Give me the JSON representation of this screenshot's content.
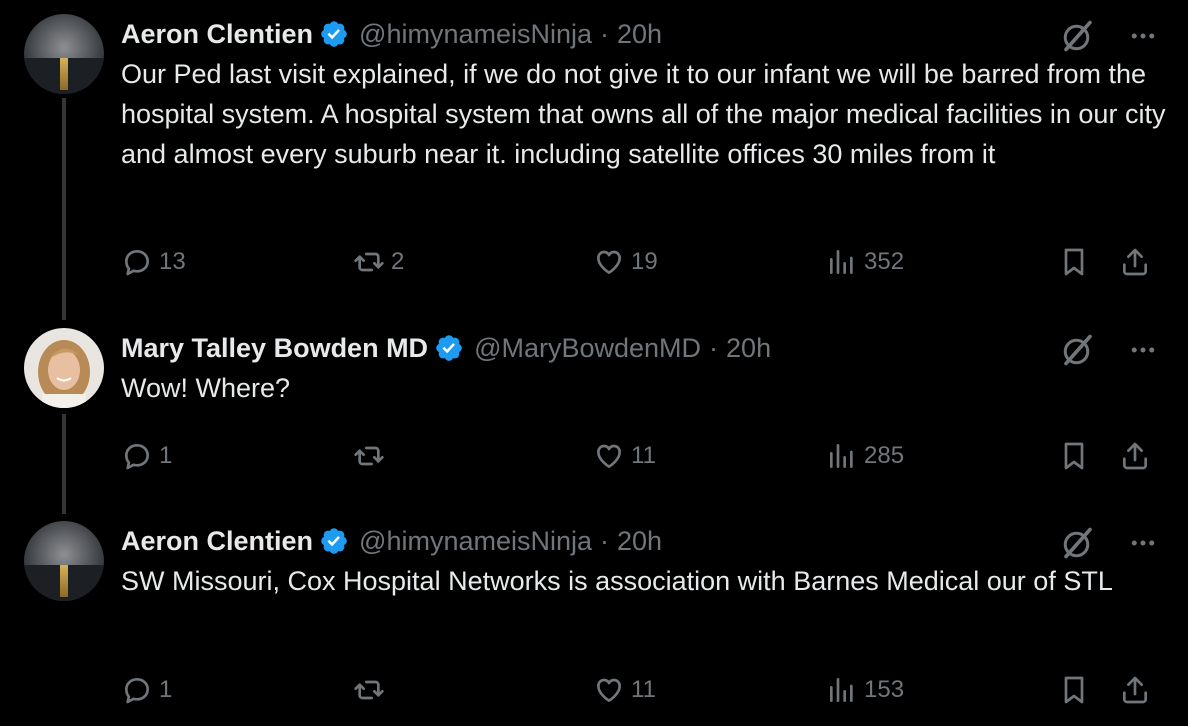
{
  "colors": {
    "background": "#000000",
    "text": "#e7e9ea",
    "muted": "#71767b",
    "verified": "#1d9bf0",
    "thread_line": "#333639"
  },
  "tweets": [
    {
      "author": {
        "name": "Aeron Clentien",
        "handle": "@himynameisNinja",
        "verified": true,
        "avatar": "moonlit-sea-avatar"
      },
      "separator": "·",
      "time": "20h",
      "text": "Our Ped last visit explained, if we do not give it to our infant we will be barred from the hospital system. A hospital system that owns all of the major medical facilities in our city and almost every suburb near it. including satellite offices 30 miles from it",
      "stats": {
        "replies": "13",
        "reposts": "2",
        "likes": "19",
        "views": "352"
      }
    },
    {
      "author": {
        "name": "Mary Talley Bowden MD",
        "handle": "@MaryBowdenMD",
        "verified": true,
        "avatar": "woman-portrait-avatar"
      },
      "separator": "·",
      "time": "20h",
      "text": "Wow!  Where?",
      "stats": {
        "replies": "1",
        "reposts": "",
        "likes": "11",
        "views": "285"
      }
    },
    {
      "author": {
        "name": "Aeron Clentien",
        "handle": "@himynameisNinja",
        "verified": true,
        "avatar": "moonlit-sea-avatar"
      },
      "separator": "·",
      "time": "20h",
      "text": "SW Missouri, Cox Hospital Networks is association with Barnes Medical our of STL",
      "stats": {
        "replies": "1",
        "reposts": "",
        "likes": "11",
        "views": "153"
      }
    }
  ]
}
